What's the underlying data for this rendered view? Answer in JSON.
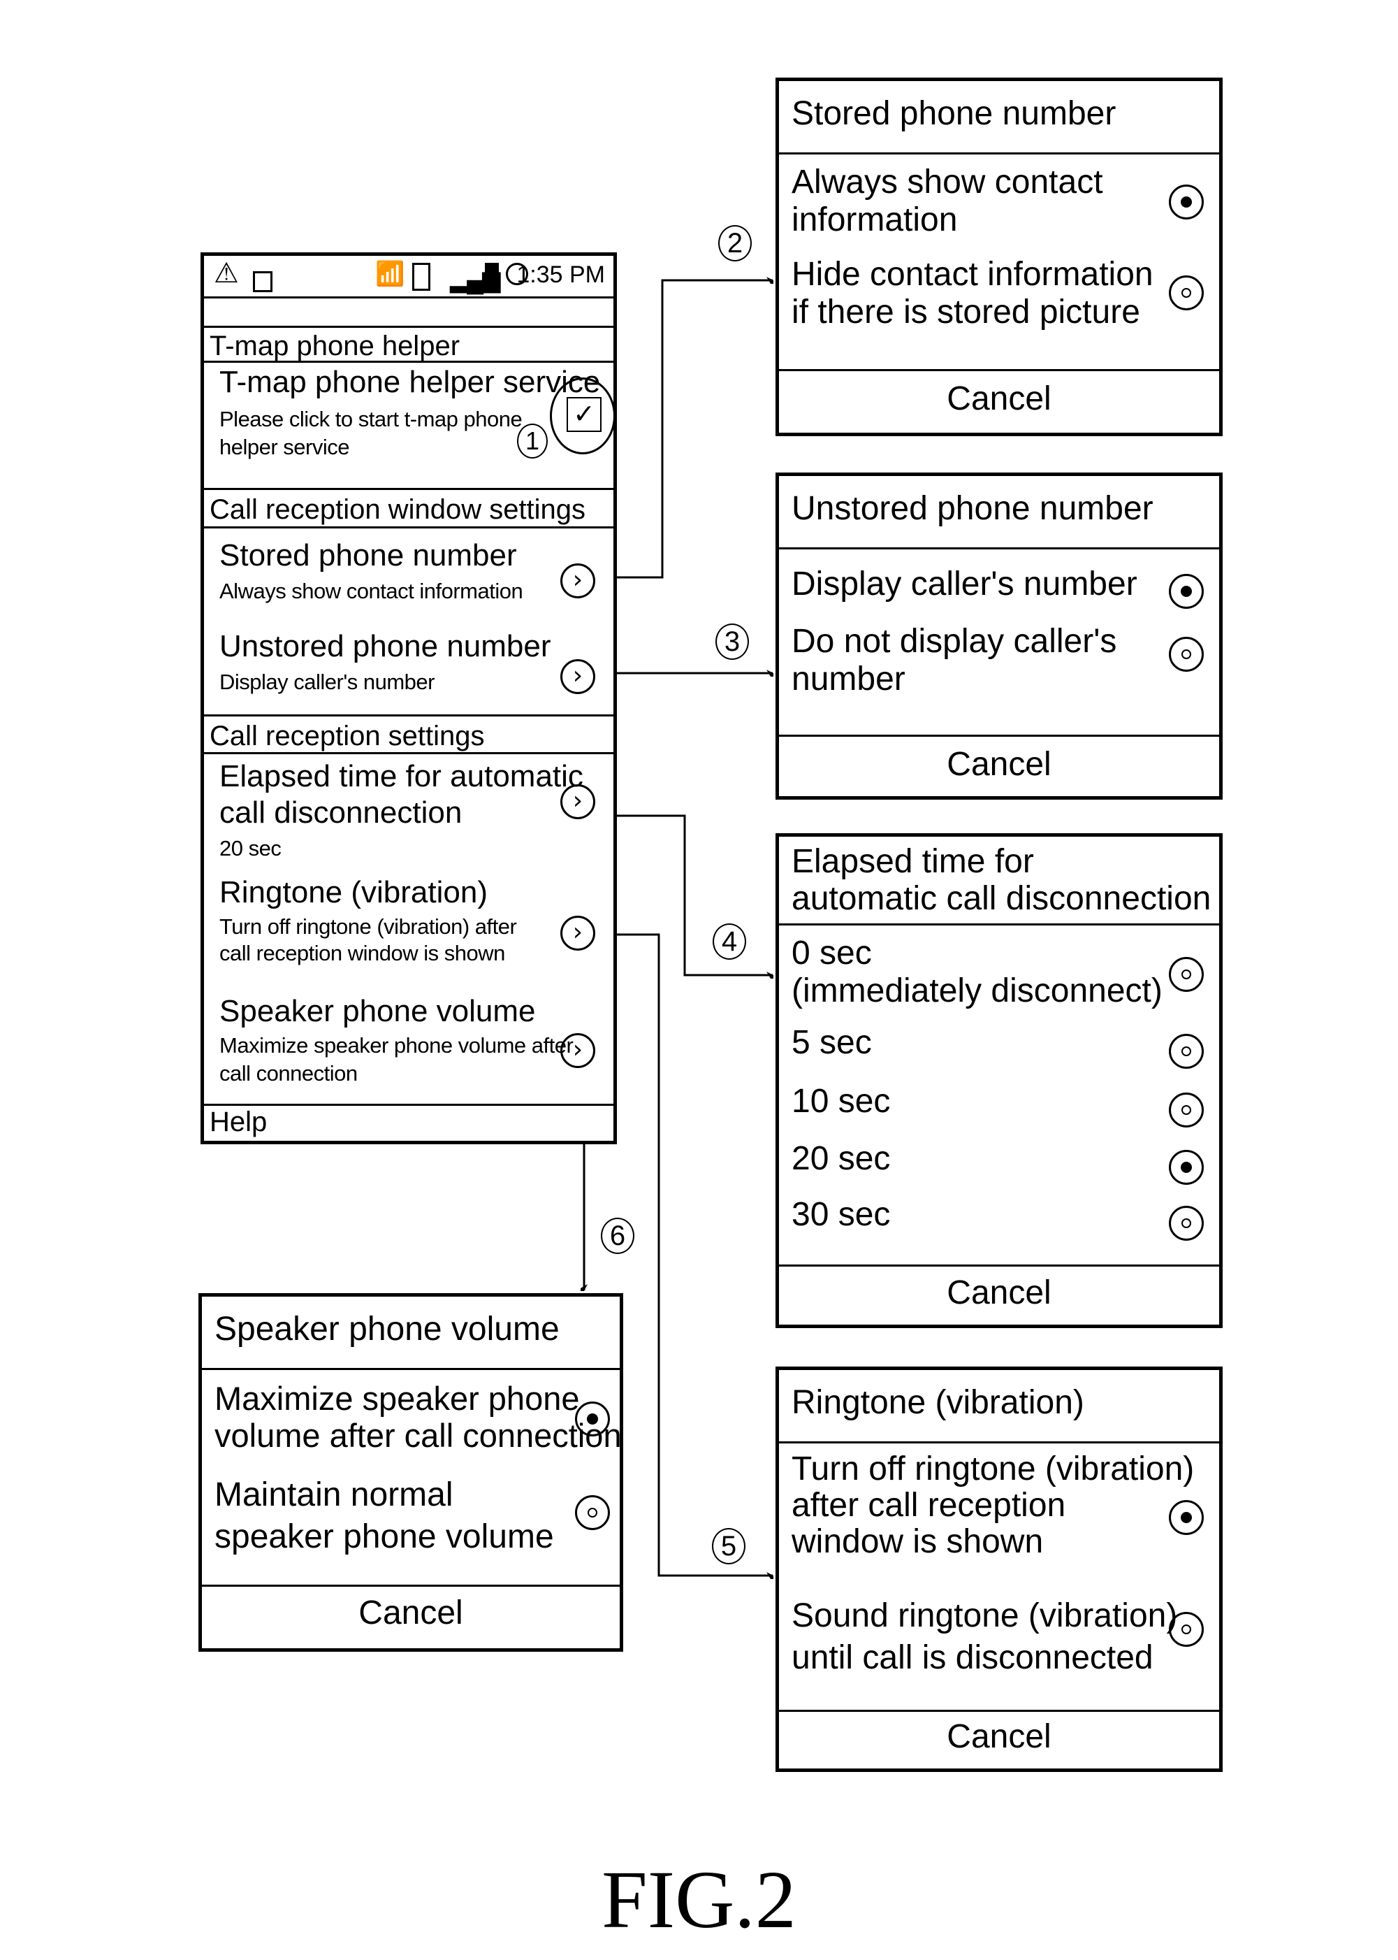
{
  "figure_label": "FIG.2",
  "phone": {
    "status_bar": {
      "left_icons": [
        "warning-icon",
        "lock-icon"
      ],
      "right_icons": [
        "wifi-icon",
        "vibrate-icon",
        "signal-icon",
        "battery-icon",
        "alarm-icon"
      ],
      "time": "1:35 PM"
    },
    "section_app": "T-map phone helper",
    "service": {
      "title": "T-map phone helper service",
      "subtitle_line1": "Please click to start t-map phone",
      "subtitle_line2": "helper service",
      "checked": true,
      "callout": "1"
    },
    "section_window": "Call reception window settings",
    "stored": {
      "title": "Stored phone number",
      "subtitle": "Always show contact information"
    },
    "unstored": {
      "title": "Unstored phone number",
      "subtitle": "Display caller's number"
    },
    "section_reception": "Call reception settings",
    "elapsed": {
      "title_line1": "Elapsed time for automatic",
      "title_line2": "call disconnection",
      "subtitle": "20 sec"
    },
    "ringtone": {
      "title": "Ringtone (vibration)",
      "subtitle_line1": "Turn off ringtone (vibration) after",
      "subtitle_line2": "call reception window is shown"
    },
    "speaker": {
      "title": "Speaker phone volume",
      "subtitle_line1": "Maximize speaker phone volume after",
      "subtitle_line2": "call connection"
    },
    "help": "Help"
  },
  "callouts": {
    "c2": "2",
    "c3": "3",
    "c4": "4",
    "c5": "5",
    "c6": "6"
  },
  "dialogs": {
    "stored": {
      "title": "Stored phone number",
      "options": [
        {
          "label": "Always show contact\ninformation",
          "selected": true
        },
        {
          "label": "Hide contact information\nif there is stored picture",
          "selected": false
        }
      ],
      "cancel": "Cancel"
    },
    "unstored": {
      "title": "Unstored phone number",
      "options": [
        {
          "label": "Display caller's number",
          "selected": true
        },
        {
          "label": "Do not display caller's\nnumber",
          "selected": false
        }
      ],
      "cancel": "Cancel"
    },
    "elapsed": {
      "title": "Elapsed time for\nautomatic call disconnection",
      "options": [
        {
          "label": "0 sec\n(immediately disconnect)",
          "selected": false
        },
        {
          "label": "5 sec",
          "selected": false
        },
        {
          "label": "10 sec",
          "selected": false
        },
        {
          "label": "20 sec",
          "selected": true
        },
        {
          "label": "30 sec",
          "selected": false
        }
      ],
      "cancel": "Cancel"
    },
    "ringtone": {
      "title": "Ringtone (vibration)",
      "options": [
        {
          "label": "Turn off ringtone (vibration)\nafter call reception\nwindow is shown",
          "selected": true
        },
        {
          "label": "Sound ringtone (vibration)\nuntil call is disconnected",
          "selected": false
        }
      ],
      "cancel": "Cancel"
    },
    "speaker": {
      "title": "Speaker phone volume",
      "options": [
        {
          "label": "Maximize speaker phone\nvolume after call connection",
          "selected": true
        },
        {
          "label": "Maintain normal\nspeaker phone volume",
          "selected": false
        }
      ],
      "cancel": "Cancel"
    }
  }
}
